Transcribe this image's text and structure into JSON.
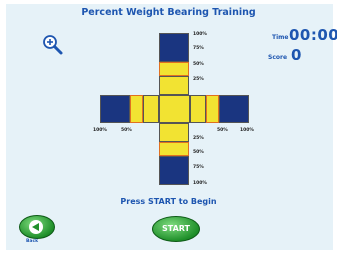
{
  "title": "Percent Weight Bearing Training",
  "time": {
    "label": "Time",
    "value": "00:00"
  },
  "score": {
    "label": "Score",
    "value": "0"
  },
  "zoom": {
    "icon": "magnifier-plus-icon"
  },
  "gauge": {
    "top_labels": [
      "100%",
      "75%",
      "50%",
      "25%"
    ],
    "bottom_labels": [
      "25%",
      "50%",
      "75%",
      "100%"
    ],
    "left_labels": [
      "100%",
      "50%"
    ],
    "right_labels": [
      "50%",
      "100%"
    ]
  },
  "prompt": "Press START to Begin",
  "buttons": {
    "back_label": "Back",
    "start_label": "START"
  },
  "colors": {
    "accent": "#1e56b0",
    "target": "#1a3580",
    "fill": "#f2e332",
    "button": "#1f8f2a"
  }
}
